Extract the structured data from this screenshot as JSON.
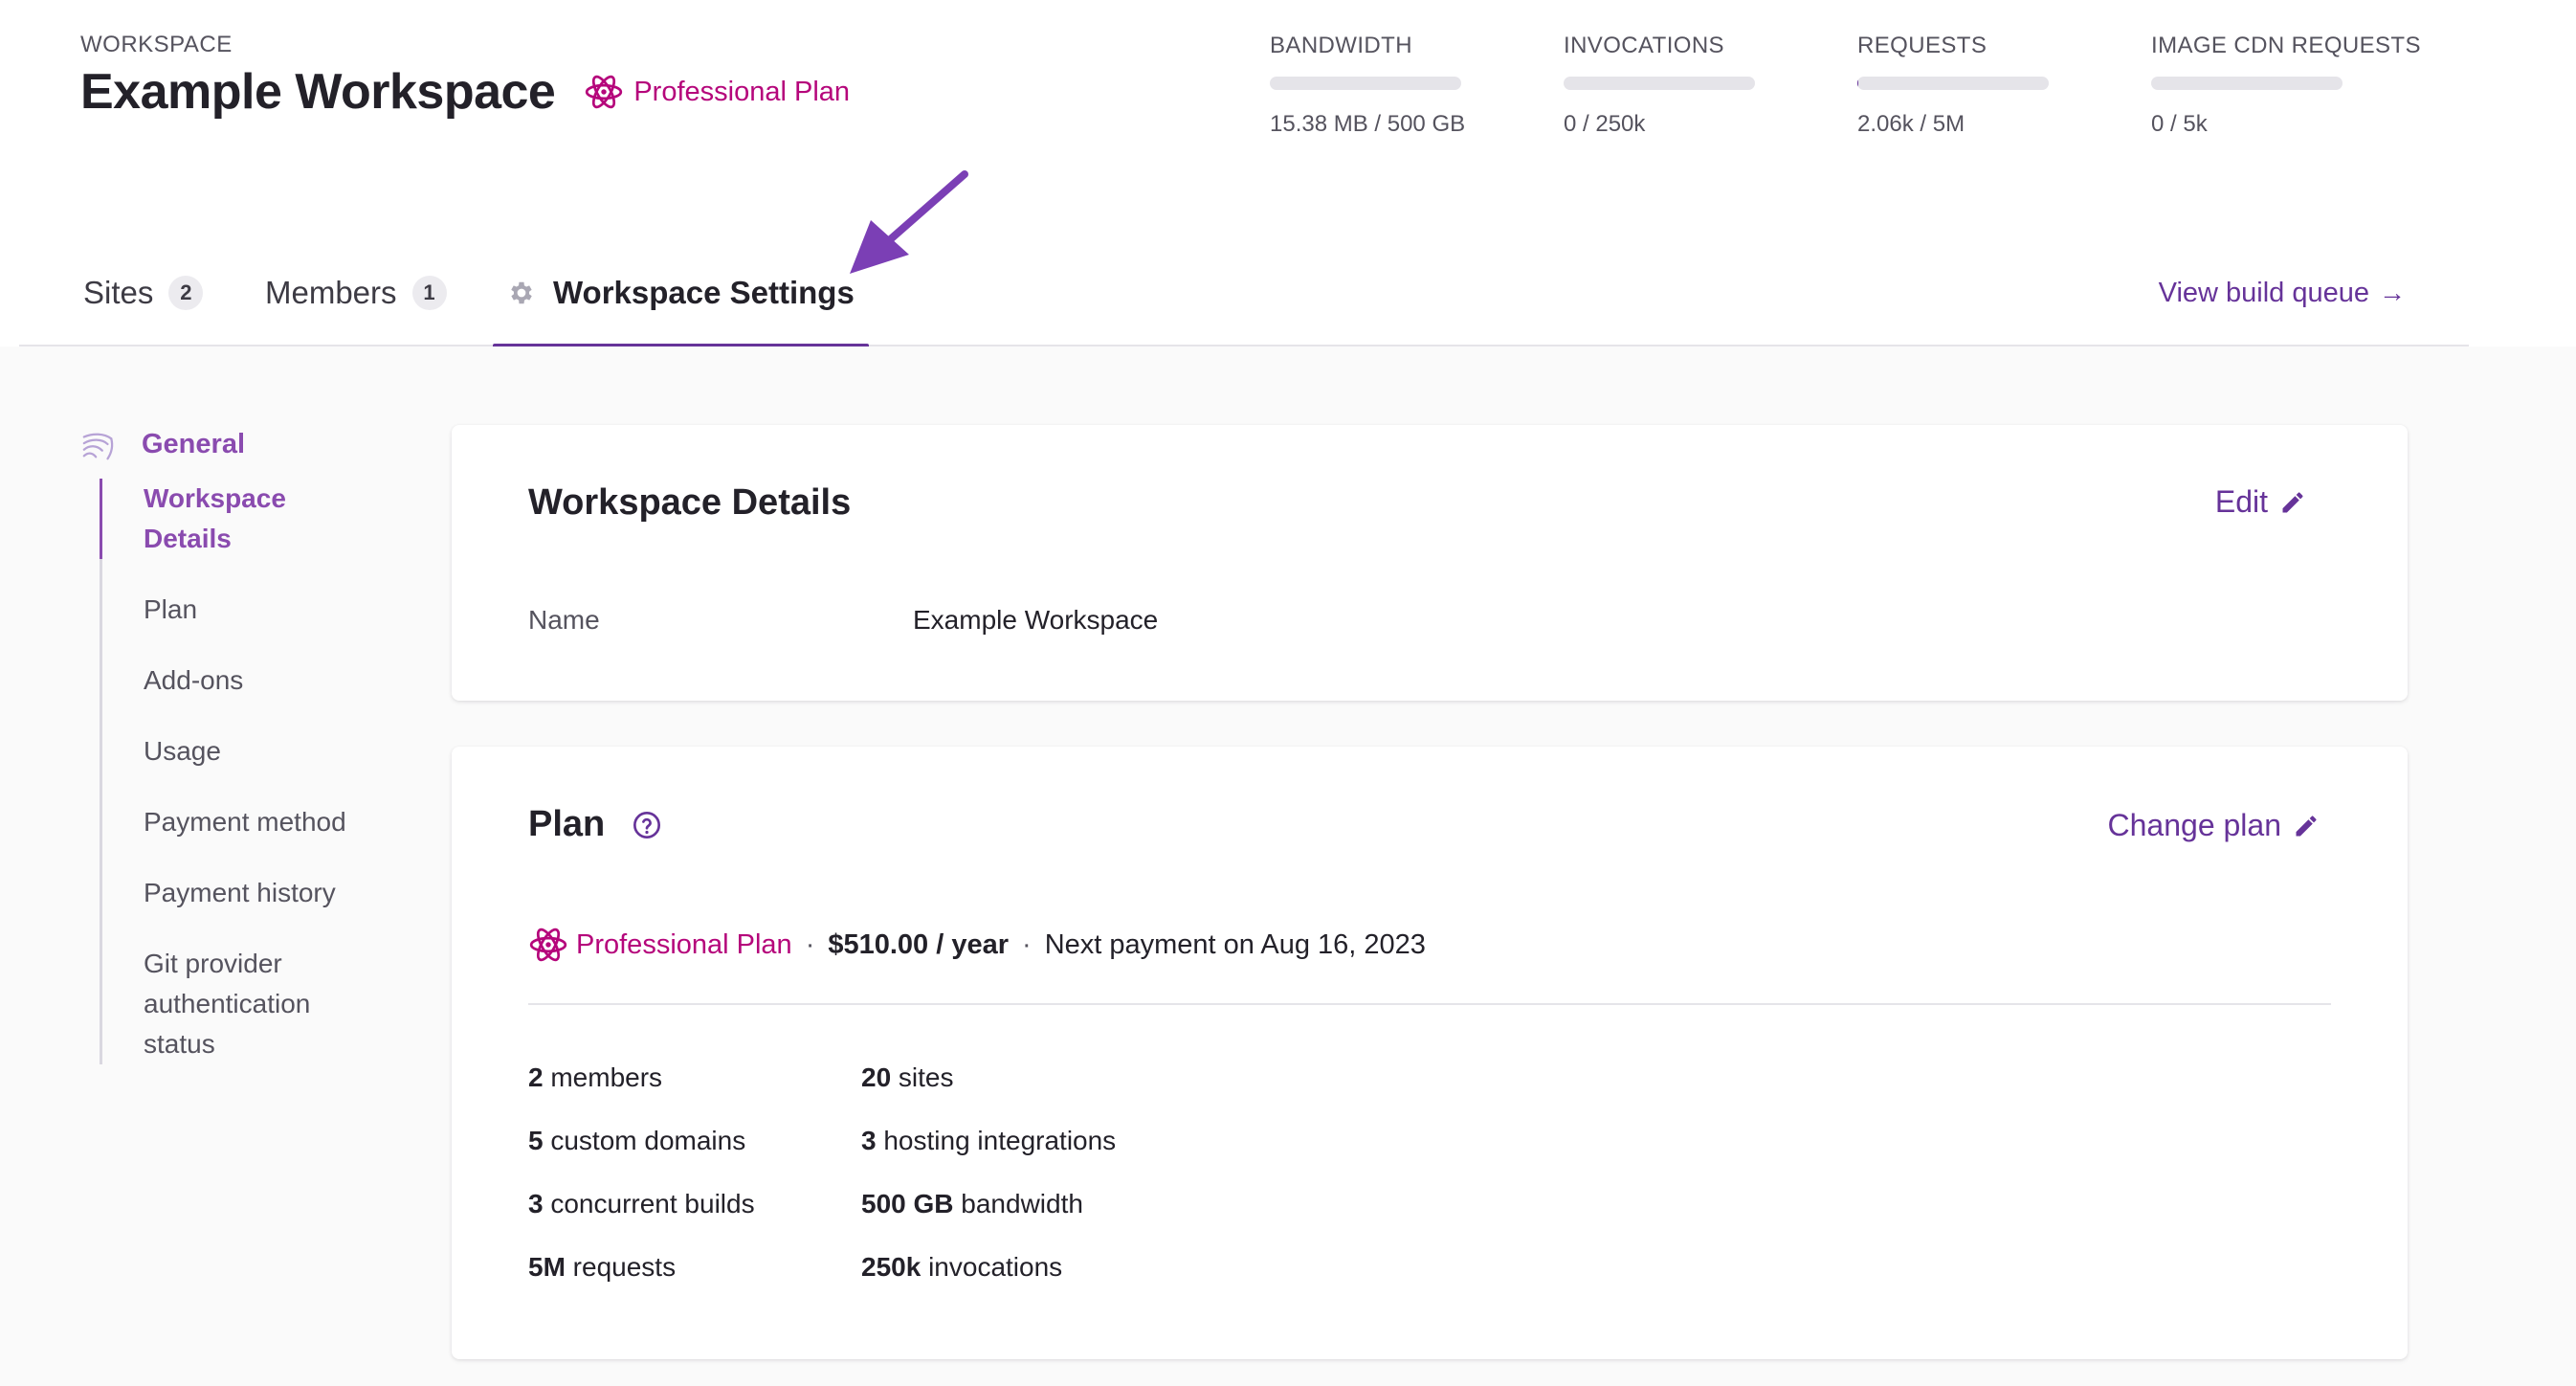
{
  "workspace": {
    "kicker": "WORKSPACE",
    "title": "Example Workspace",
    "plan_badge": "Professional Plan"
  },
  "usage": [
    {
      "label": "BANDWIDTH",
      "value": "15.38 MB / 500 GB",
      "fraction": 3e-05
    },
    {
      "label": "INVOCATIONS",
      "value": "0 / 250k",
      "fraction": 0
    },
    {
      "label": "REQUESTS",
      "value": "2.06k / 5M",
      "fraction": 0.0004
    },
    {
      "label": "IMAGE CDN REQUESTS",
      "value": "0 / 5k",
      "fraction": 0
    }
  ],
  "tabs": {
    "sites": {
      "label": "Sites",
      "count": "2"
    },
    "members": {
      "label": "Members",
      "count": "1"
    },
    "settings": {
      "label": "Workspace Settings"
    },
    "view_queue": "View build queue",
    "view_queue_arrow": "→"
  },
  "sidenav": {
    "section": "General",
    "items": [
      {
        "label": "Workspace Details",
        "active": true
      },
      {
        "label": "Plan"
      },
      {
        "label": "Add-ons"
      },
      {
        "label": "Usage"
      },
      {
        "label": "Payment method"
      },
      {
        "label": "Payment history"
      },
      {
        "label": "Git provider authentication status"
      }
    ]
  },
  "details_card": {
    "title": "Workspace Details",
    "edit_label": "Edit",
    "name_label": "Name",
    "name_value": "Example Workspace"
  },
  "plan_card": {
    "title": "Plan",
    "change_label": "Change plan",
    "plan_name": "Professional Plan",
    "separator": "·",
    "price": "$510.00 / year",
    "next_payment": "Next payment on Aug 16, 2023",
    "features": [
      {
        "num": "2",
        "text": " members"
      },
      {
        "num": "20",
        "text": " sites"
      },
      {
        "num": "5",
        "text": " custom domains"
      },
      {
        "num": "3",
        "text": " hosting integrations"
      },
      {
        "num": "3",
        "text": " concurrent builds"
      },
      {
        "num": "500 GB",
        "text": " bandwidth"
      },
      {
        "num": "5M",
        "text": " requests"
      },
      {
        "num": "250k",
        "text": " invocations"
      }
    ]
  },
  "colors": {
    "accent": "#663399",
    "plan_pink": "#b5067b",
    "nav_active": "#8a4baf",
    "annotation_arrow": "#7b3fb5"
  },
  "icons": [
    "atom-icon",
    "gear-icon",
    "arrow-right-icon",
    "pencil-icon",
    "help-circle-icon",
    "general-swirl-icon",
    "annotation-arrow-icon"
  ]
}
